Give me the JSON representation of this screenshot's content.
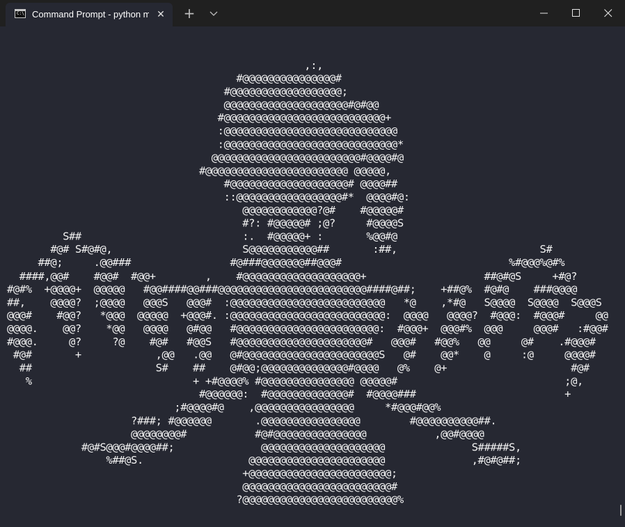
{
  "window": {
    "tab_title": "Command Prompt - python  ma",
    "tab_icon": "cmd-icon",
    "tab_icon_text": "C:\\",
    "close_tab_glyph": "✕",
    "new_tab_glyph": "+",
    "controls": {
      "minimize": "minimize-icon",
      "maximize": "maximize-icon",
      "close": "close-icon"
    }
  },
  "theme": {
    "background": "#262832",
    "titlebar": "#202020",
    "foreground": "#f2f2f2"
  },
  "console": {
    "lines": [
      "                                                ,:,",
      "                                     #@@@@@@@@@@@@@@@#",
      "                                   #@@@@@@@@@@@@@@@@@@;",
      "                                   @@@@@@@@@@@@@@@@@@@@#@#@@",
      "                                  #@@@@@@@@@@@@@@@@@@@@@@@@@@+",
      "                                  :@@@@@@@@@@@@@@@@@@@@@@@@@@@@",
      "                                  :@@@@@@@@@@@@@@@@@@@@@@@@@@@@*",
      "                                 @@@@@@@@@@@@@@@@@@@@@@@@#@@@@#@",
      "                               #@@@@@@@@@@@@@@@@@@@@@@@ @@@@@,",
      "                                   #@@@@@@@@@@@@@@@@@@@# @@@@##",
      "                                   ::@@@@@@@@@@@@@@@@@#*  @@@@#@:",
      "                                      @@@@@@@@@@@@?@#    #@@@@@#",
      "                                      #?: #@@@@@# ;@?     #@@@@S",
      "         S##                          :.  #@@@@@+ :       %@@#@",
      "       #@# S#@#@,                     S@@@@@@@@@@@##       :##,                       S#",
      "     ##@;     .@@###                #@###@@@@@@@##@@@#                           %#@@@%@#%",
      "  ####,@@#    #@@#  #@@+        ,    #@@@@@@@@@@@@@@@@@@@+                   ##@#@S     +#@?",
      "#@#%  +@@@@+  @@@@@   #@@####@@###@@@@@@@@@@@@@@@@@@@@@@@@####@##;    +##@%  #@#@    ###@@@@",
      "##,    @@@@?  ;@@@@   @@@S   @@@#  :@@@@@@@@@@@@@@@@@@@@@@@@@   *@    ,*#@   S@@@@  S@@@@  S@@@S",
      "@@@#    #@@?   *@@@  @@@@@  +@@@#. :@@@@@@@@@@@@@@@@@@@@@@@@@:  @@@@   @@@@?  #@@@:  #@@@#     @@",
      "@@@@.    @@?    *@@   @@@@   @#@@   #@@@@@@@@@@@@@@@@@@@@@@@:  #@@@+  @@@#%  @@@     @@@#   :#@@#",
      "#@@@.     @?     ?@    #@#   #@@S   #@@@@@@@@@@@@@@@@@@@@@#   @@@#   #@@%   @@     @#    .#@@@#",
      " #@#       +            ,@@   .@@   @#@@@@@@@@@@@@@@@@@@@@@@S   @#    @@*    @     :@     @@@@#",
      "  ##                    S#    ##    @#@@;@@@@@@@@@@@@@@#@@@@   @%    @+                    #@#",
      "   %                          + +#@@@@% #@@@@@@@@@@@@@@@ @@@@@#                           ;@,",
      "                               #@@@@@@:  #@@@@@@@@@@@@@#  #@@@@###                        +",
      "                           ;#@@@@#@    ,@@@@@@@@@@@@@@@@     *#@@@#@@%",
      "                    ?###; #@@@@@@       .@@@@@@@@@@@@@@@@        #@@@@@@@@@@##.",
      "                    @@@@@@@@#           #@#@@@@@@@@@@@@@@@           ,@@#@@@@",
      "            #@#S@@@#@@@@##;              @@@@@@@@@@@@@@@@@@@@              S#####S,",
      "                %##@S.                 @@@@@@@@@@@@@@@@@@@@@@              ,#@#@##;",
      "                                      +@@@@@@@@@@@@@@@@@@@@@@@;",
      "                                      @@@@@@@@@@@@@@@@@@@@@@@@#",
      "                                     ?@@@@@@@@@@@@@@@@@@@@@@@@@%"
    ]
  }
}
